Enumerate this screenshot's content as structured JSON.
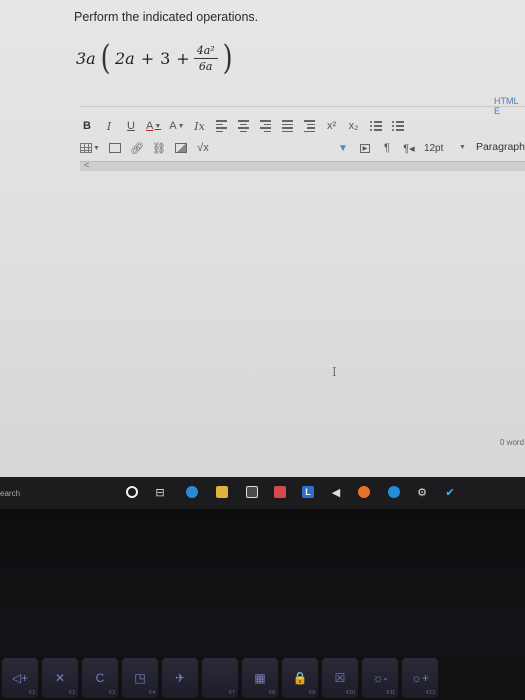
{
  "question": {
    "prompt": "Perform the indicated operations.",
    "coef": "3a",
    "inner_a": "2a",
    "plus1": "+",
    "three": "3",
    "plus2": "+",
    "numerator": "4a²",
    "denominator": "6a"
  },
  "editor": {
    "html_link": "HTML E",
    "font_size": "12pt",
    "block_format": "Paragraph",
    "word_count": "0 word",
    "toolbar": {
      "bold": "B",
      "italic": "I",
      "underline": "U",
      "font_color": "A",
      "bg_color": "A",
      "clear_format": "Ix",
      "superscript": "x²",
      "subscript": "x₂",
      "sqrt": "√x",
      "pilcrow_ltr": "¶",
      "pilcrow_rtl": "¶◂"
    },
    "cursor": "I",
    "scroll_arrow": "<"
  },
  "taskbar": {
    "search_text": "earch",
    "task_view": "⊟",
    "app_colors": {
      "edge": "#2a8bd6",
      "files": "#e0b43a",
      "store": "#4a4a4a",
      "mail": "#d24a4a",
      "l_app": "#2d6fcc",
      "firefox": "#e8722a",
      "chrome_like": "#1f8fd9",
      "gear": "#e6e6e6",
      "check": "#4ab3ff"
    },
    "l_label": "L"
  },
  "keyboard": {
    "keys": [
      {
        "icon": "◁+",
        "fn": "F2"
      },
      {
        "icon": "✕",
        "fn": "F2"
      },
      {
        "icon": "C",
        "fn": "F3"
      },
      {
        "icon": "◳",
        "fn": "F4"
      },
      {
        "icon": "✈",
        "fn": ""
      },
      {
        "icon": "",
        "fn": "F7"
      },
      {
        "icon": "▦",
        "fn": "F8"
      },
      {
        "icon": "🔒",
        "fn": "F9"
      },
      {
        "icon": "☒",
        "fn": "F10"
      },
      {
        "icon": "☼-",
        "fn": "F11"
      },
      {
        "icon": "☼+",
        "fn": "F12"
      }
    ]
  }
}
